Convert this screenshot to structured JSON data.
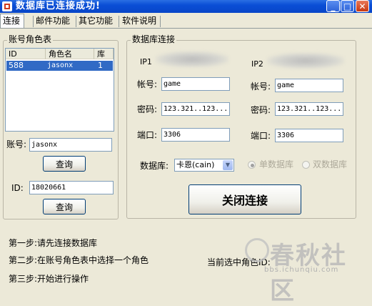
{
  "window": {
    "title": "数据库已连接成功!",
    "minimize": "_",
    "maximize": "□",
    "close": "✕"
  },
  "tabs": [
    {
      "label": "连接"
    },
    {
      "label": "邮件功能"
    },
    {
      "label": "其它功能"
    },
    {
      "label": "软件说明"
    }
  ],
  "account_group": {
    "legend": "账号角色表",
    "columns": [
      "ID",
      "角色名",
      "库"
    ],
    "rows": [
      {
        "id": "588",
        "name": "jasonx",
        "db": "1"
      }
    ],
    "account_label": "账号:",
    "account_value": "jasonx",
    "query_button": "查询",
    "id_label": "ID:",
    "id_value": "18020661",
    "query_button2": "查询"
  },
  "db_group": {
    "legend": "数据库连接",
    "ip1_label": "IP1",
    "ip2_label": "IP2",
    "left": {
      "account_label": "帐号:",
      "account_value": "game",
      "password_label": "密码:",
      "password_value": "123.321..123...",
      "port_label": "端口:",
      "port_value": "3306"
    },
    "right": {
      "account_label": "帐号:",
      "account_value": "game",
      "password_label": "密码:",
      "password_value": "123.321..123...",
      "port_label": "端口:",
      "port_value": "3306"
    },
    "database_label": "数据库:",
    "database_selected": "卡恩(cain)",
    "single_db": "单数据库",
    "double_db": "双数据库",
    "close_button": "关闭连接"
  },
  "steps": {
    "step1": "第一步:请先连接数据库",
    "step2": "第二步:在账号角色表中选择一个角色",
    "step3": "第三步:开始进行操作",
    "current_role_label": "当前选中角色ID:"
  },
  "watermark": {
    "main": "春秋社区",
    "sub": "bbs.ichunqiu.com"
  },
  "colors": {
    "titlebar": "#0a4ed6",
    "selection": "#316ac5",
    "window_bg": "#ece9d8"
  },
  "icons": {
    "app": "app-icon",
    "dropdown": "chevron-down-icon",
    "watermark": "watermark-logo-icon"
  }
}
